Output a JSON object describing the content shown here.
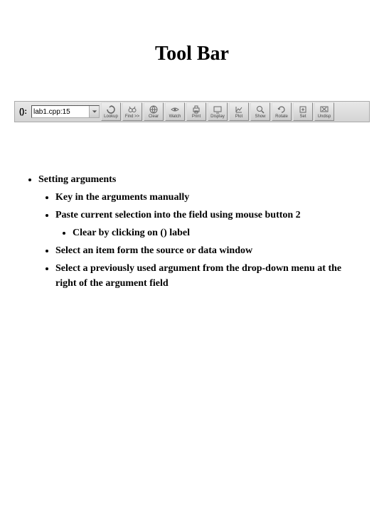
{
  "title": "Tool Bar",
  "toolbar": {
    "paren_label": "():",
    "input_value": "lab1.cpp:15",
    "buttons": [
      {
        "name": "lookup-button",
        "label": "Lookup",
        "icon": "rotate-icon"
      },
      {
        "name": "find-button",
        "label": "Find >>",
        "icon": "binoculars-icon"
      },
      {
        "name": "clear-button",
        "label": "Clear",
        "icon": "globe-icon"
      },
      {
        "name": "watch-button",
        "label": "Watch",
        "icon": "eye-icon"
      },
      {
        "name": "print-button",
        "label": "Print",
        "icon": "printer-icon"
      },
      {
        "name": "display-button",
        "label": "Display",
        "icon": "display-icon"
      },
      {
        "name": "plot-button",
        "label": "Plot",
        "icon": "plot-icon"
      },
      {
        "name": "show-button",
        "label": "Show",
        "icon": "magnify-icon"
      },
      {
        "name": "rotate-button",
        "label": "Rotate",
        "icon": "rotate2-icon"
      },
      {
        "name": "set-button",
        "label": "Set",
        "icon": "set-icon"
      },
      {
        "name": "undisp-button",
        "label": "Undisp",
        "icon": "undisp-icon"
      }
    ]
  },
  "content": {
    "heading": "Setting arguments",
    "items": [
      "Key in the arguments manually",
      "Paste current selection into the field using mouse button 2",
      "Select an item form the source or data window",
      "Select a previously used argument from the drop-down menu at the right of the argument field"
    ],
    "subitem": "Clear by clicking on () label"
  }
}
